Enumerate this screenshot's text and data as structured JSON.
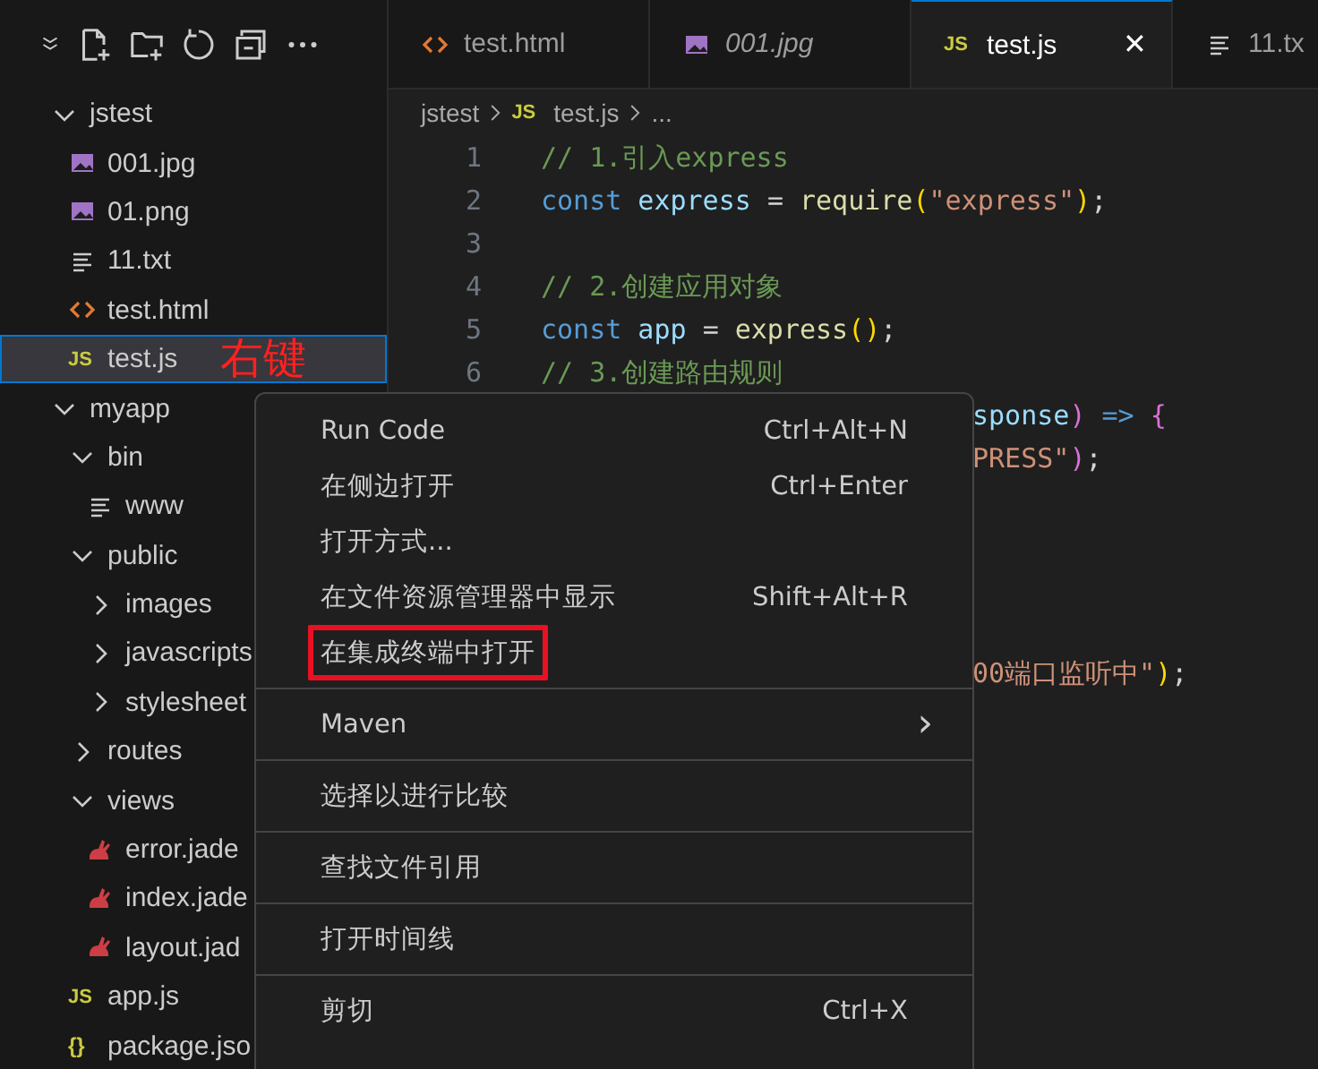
{
  "tabs": [
    {
      "label": "test.html",
      "kind": "html",
      "selected": false,
      "preview": false
    },
    {
      "label": "001.jpg",
      "kind": "image",
      "selected": false,
      "preview": true
    },
    {
      "label": "test.js",
      "kind": "js",
      "icon": "JS",
      "selected": true,
      "preview": false,
      "close": "✕"
    },
    {
      "label": "11.tx",
      "kind": "text",
      "selected": false,
      "preview": false
    }
  ],
  "breadcrumb": [
    {
      "label": "jstest",
      "kind": "folder"
    },
    {
      "label": "test.js",
      "kind": "js",
      "icon": "JS"
    },
    {
      "label": "...",
      "kind": "more"
    }
  ],
  "tree": [
    {
      "label": "jstest",
      "kind": "folder",
      "expanded": true,
      "selected": false,
      "children": [
        {
          "label": "001.jpg",
          "kind": "image",
          "selected": false
        },
        {
          "label": "01.png",
          "kind": "image",
          "selected": false
        },
        {
          "label": "11.txt",
          "kind": "text",
          "selected": false
        },
        {
          "label": "test.html",
          "kind": "html",
          "selected": false
        },
        {
          "label": "test.js",
          "kind": "js",
          "icon": "JS",
          "selected": true
        }
      ]
    },
    {
      "label": "myapp",
      "kind": "folder",
      "expanded": true,
      "selected": false,
      "children": [
        {
          "label": "bin",
          "kind": "folder",
          "expanded": true,
          "selected": false,
          "children": [
            {
              "label": "www",
              "kind": "text",
              "selected": false
            }
          ]
        },
        {
          "label": "public",
          "kind": "folder",
          "expanded": true,
          "selected": false,
          "children": [
            {
              "label": "images",
              "kind": "folder",
              "expanded": false,
              "selected": false
            },
            {
              "label": "javascripts",
              "kind": "folder",
              "expanded": false,
              "selected": false
            },
            {
              "label": "stylesheet",
              "kind": "folder",
              "expanded": false,
              "selected": false
            }
          ]
        },
        {
          "label": "routes",
          "kind": "folder",
          "expanded": false,
          "selected": false
        },
        {
          "label": "views",
          "kind": "folder",
          "expanded": true,
          "selected": false,
          "children": [
            {
              "label": "error.jade",
              "kind": "jade",
              "selected": false
            },
            {
              "label": "index.jade",
              "kind": "jade",
              "selected": false
            },
            {
              "label": "layout.jad",
              "kind": "jade",
              "selected": false
            }
          ]
        },
        {
          "label": "app.js",
          "kind": "js",
          "icon": "JS",
          "selected": false
        },
        {
          "label": "package.jso",
          "kind": "json",
          "icon": "{}",
          "selected": false
        }
      ]
    }
  ],
  "annotation": "右键",
  "code": [
    {
      "num": "1",
      "kind": "full",
      "tokens": [
        {
          "t": "// 1.引入express",
          "color": "#6a9955"
        }
      ]
    },
    {
      "num": "2",
      "kind": "full",
      "tokens": [
        {
          "t": "const",
          "color": "#569cd6"
        },
        {
          "t": " express ",
          "color": "#9cdcfe"
        },
        {
          "t": "= ",
          "color": "#d4d4d4"
        },
        {
          "t": "require",
          "color": "#dcdcaa"
        },
        {
          "t": "(",
          "color": "#ffd700"
        },
        {
          "t": "\"express\"",
          "color": "#ce9178"
        },
        {
          "t": ")",
          "color": "#ffd700"
        },
        {
          "t": ";",
          "color": "#d4d4d4"
        }
      ]
    },
    {
      "num": "3",
      "kind": "full"
    },
    {
      "num": "4",
      "kind": "full",
      "tokens": [
        {
          "t": "// 2.创建应用对象",
          "color": "#6a9955"
        }
      ]
    },
    {
      "num": "5",
      "kind": "full",
      "tokens": [
        {
          "t": "const",
          "color": "#569cd6"
        },
        {
          "t": " app ",
          "color": "#9cdcfe"
        },
        {
          "t": "= ",
          "color": "#d4d4d4"
        },
        {
          "t": "express",
          "color": "#dcdcaa"
        },
        {
          "t": "()",
          "color": "#ffd700"
        },
        {
          "t": ";",
          "color": "#d4d4d4"
        }
      ]
    },
    {
      "num": "6",
      "kind": "full",
      "tokens": [
        {
          "t": "// 3.创建路由规则",
          "color": "#6a9955"
        }
      ]
    },
    {
      "kind": "partial",
      "tokens": [
        {
          "t": "sponse",
          "color": "#9cdcfe"
        },
        {
          "t": ")",
          "color": "#da70d6"
        },
        {
          "t": " => ",
          "color": "#569cd6"
        },
        {
          "t": "{",
          "color": "#da70d6"
        }
      ]
    },
    {
      "kind": "partial",
      "tokens": [
        {
          "t": "PRESS\"",
          "color": "#ce9178"
        },
        {
          "t": ")",
          "color": "#da70d6"
        },
        {
          "t": ";",
          "color": "#d4d4d4"
        }
      ]
    },
    {
      "kind": "partial"
    },
    {
      "kind": "partial"
    },
    {
      "kind": "partial"
    },
    {
      "kind": "partial"
    },
    {
      "kind": "partial",
      "tokens": [
        {
          "t": "00端口监听中\"",
          "color": "#ce9178"
        },
        {
          "t": ")",
          "color": "#ffd700"
        },
        {
          "t": ";",
          "color": "#d4d4d4"
        }
      ]
    }
  ],
  "menu": [
    [
      {
        "label": "Run Code",
        "shortcut": "Ctrl+Alt+N",
        "highlighted": false
      },
      {
        "label": "在侧边打开",
        "shortcut": "Ctrl+Enter",
        "highlighted": false
      },
      {
        "label": "打开方式...",
        "highlighted": false
      },
      {
        "label": "在文件资源管理器中显示",
        "shortcut": "Shift+Alt+R",
        "highlighted": false
      },
      {
        "label": "在集成终端中打开",
        "highlighted": true
      }
    ],
    [
      {
        "label": "Maven",
        "submenu": "›",
        "highlighted": false
      }
    ],
    [
      {
        "label": "选择以进行比较",
        "highlighted": false
      }
    ],
    [
      {
        "label": "查找文件引用",
        "highlighted": false
      }
    ],
    [
      {
        "label": "打开时间线",
        "highlighted": false
      }
    ],
    [
      {
        "label": "剪切",
        "shortcut": "Ctrl+X",
        "highlighted": false
      }
    ]
  ]
}
